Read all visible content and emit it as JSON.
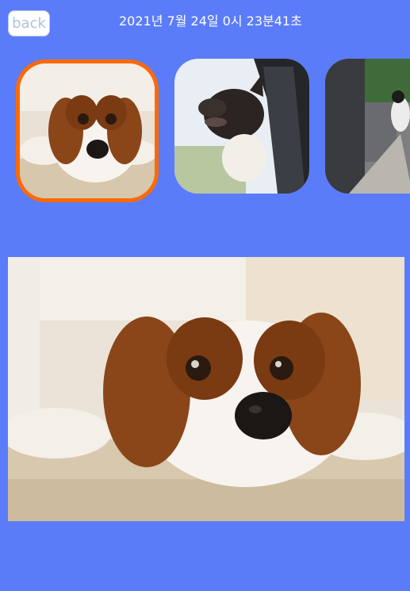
{
  "header": {
    "back_label": "back",
    "timestamp": "2021년 7월 24일 0시 23분41초"
  },
  "thumbnails": [
    {
      "subject": "spaniel-lying-on-carpet",
      "selected": true
    },
    {
      "subject": "dog-looking-out-car-window",
      "selected": false
    },
    {
      "subject": "dog-on-sidewalk",
      "selected": false
    }
  ],
  "main_image": {
    "subject": "spaniel-lying-on-carpet"
  },
  "colors": {
    "background": "#5b7cf9",
    "selection_border": "#ff6a00",
    "timestamp_text": "#ffffff",
    "back_text": "#a9c6de"
  }
}
